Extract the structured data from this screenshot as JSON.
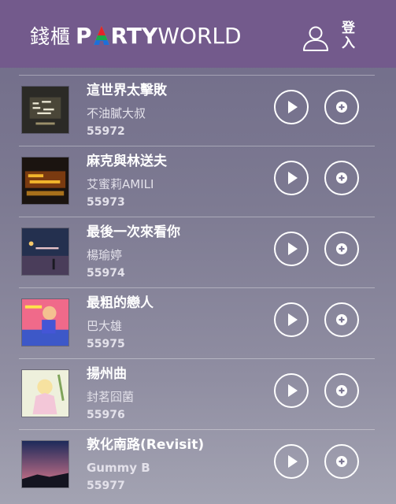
{
  "header": {
    "logo_cn": "錢櫃",
    "logo_party": "P",
    "logo_party_rest": "RTY",
    "logo_world": "WORLD",
    "login_label": "登入",
    "brand_bg": "#735a8c"
  },
  "songs": [
    {
      "title": "這世界太擊敗",
      "artist": "不油膩大叔",
      "code": "55972",
      "artist_bold": false
    },
    {
      "title": "麻克與林送夫",
      "artist": "艾蜜莉AMILI",
      "code": "55973",
      "artist_bold": false
    },
    {
      "title": "最後一次來看你",
      "artist": "楊瑜婷",
      "code": "55974",
      "artist_bold": false
    },
    {
      "title": "最粗的戀人",
      "artist": "巴大雄",
      "code": "55975",
      "artist_bold": false
    },
    {
      "title": "揚州曲",
      "artist": "封茗囧菌",
      "code": "55976",
      "artist_bold": false
    },
    {
      "title": "敦化南路(Revisit)",
      "artist": "Gummy B",
      "code": "55977",
      "artist_bold": true
    }
  ],
  "icons": {
    "user": "user-icon",
    "play": "play-icon",
    "add": "plus-icon"
  }
}
